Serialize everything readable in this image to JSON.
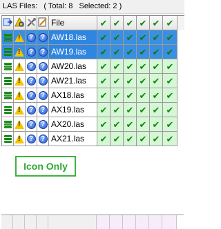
{
  "title": {
    "label": "LAS Files:",
    "stats": "( Total: 8   Selected: 2 )"
  },
  "header": {
    "file_label": "File",
    "icons": [
      "export-icon",
      "search-warning-icon",
      "tools-icon",
      "edit-icon"
    ]
  },
  "rows": [
    {
      "name": "AW18.las",
      "selected": true
    },
    {
      "name": "AW19.las",
      "selected": true
    },
    {
      "name": "AW20.las",
      "selected": false
    },
    {
      "name": "AW21.las",
      "selected": false
    },
    {
      "name": "AX18.las",
      "selected": false
    },
    {
      "name": "AX19.las",
      "selected": false
    },
    {
      "name": "AX20.las",
      "selected": false
    },
    {
      "name": "AX21.las",
      "selected": false
    }
  ],
  "check_columns": 6,
  "badge": {
    "label": "Icon Only"
  },
  "colors": {
    "selection": "#3b8fe0",
    "check_bg": "#d6f6d6",
    "accent": "#3cb43c"
  }
}
